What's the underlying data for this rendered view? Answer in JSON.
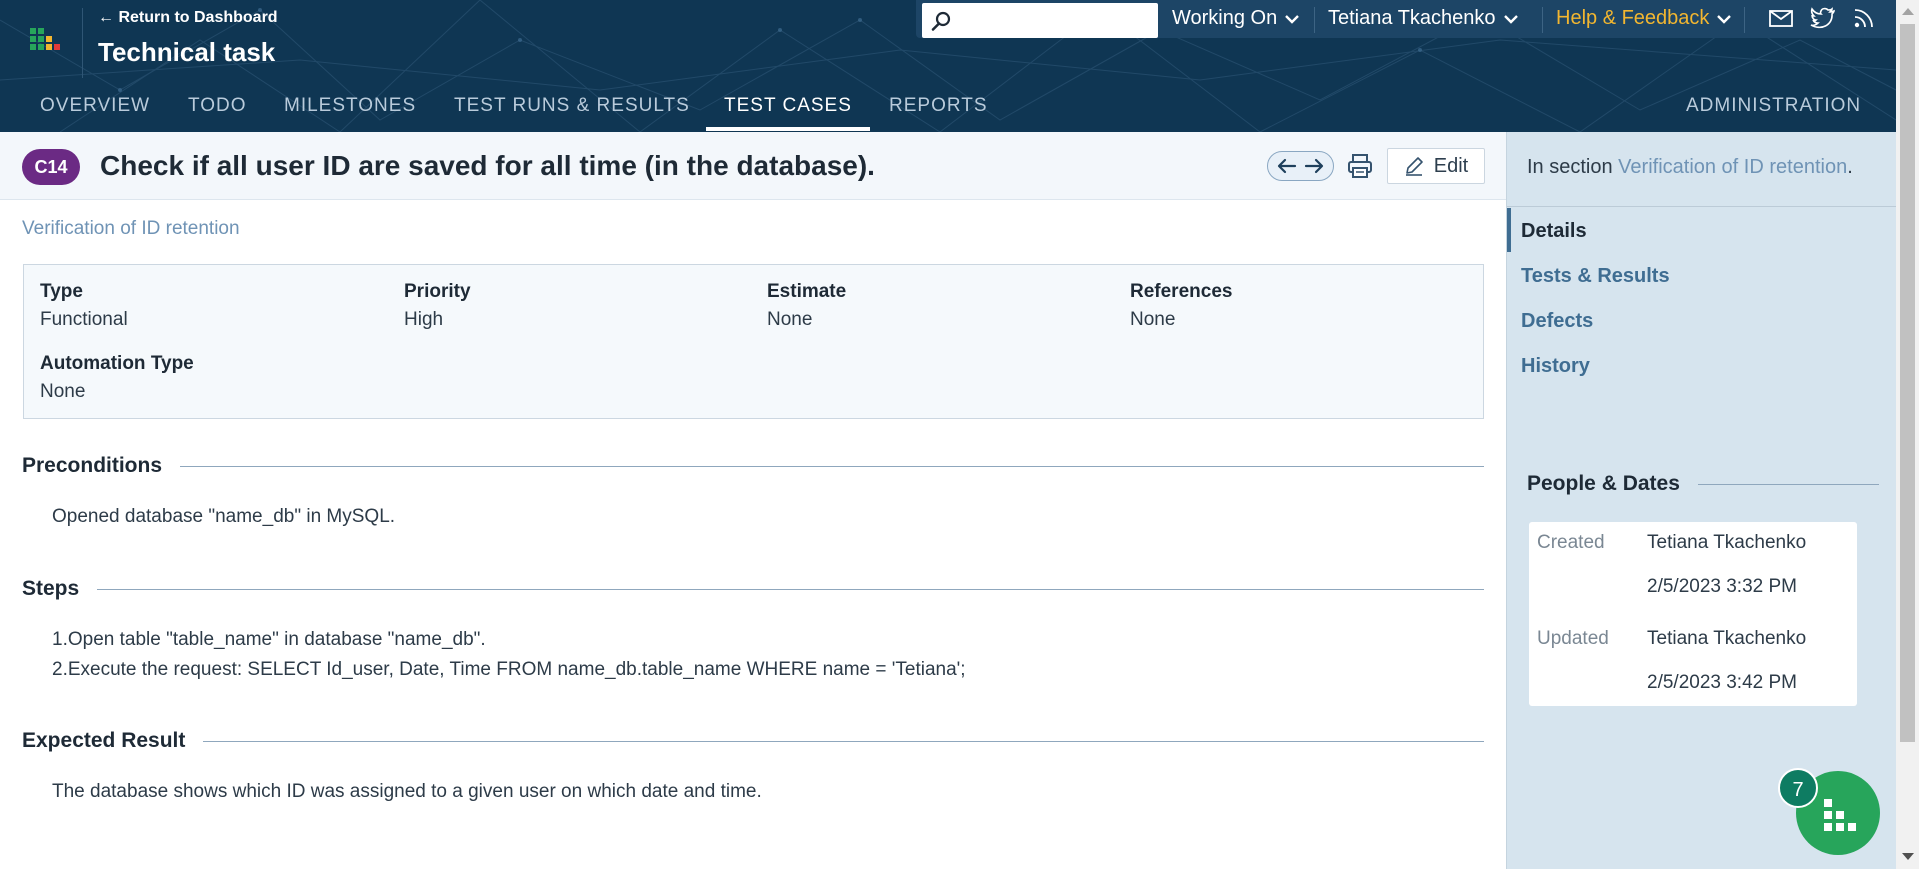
{
  "header": {
    "return_link": "← Return to Dashboard",
    "project_title": "Technical task",
    "search_placeholder": "",
    "working_on": "Working On",
    "user": "Tetiana Tkachenko",
    "help": "Help & Feedback",
    "icons": [
      "logo-icon",
      "search-icon",
      "chevron-down-icon",
      "mail-icon",
      "twitter-icon",
      "rss-icon"
    ]
  },
  "nav": {
    "tabs": [
      "OVERVIEW",
      "TODO",
      "MILESTONES",
      "TEST RUNS & RESULTS",
      "TEST CASES",
      "REPORTS"
    ],
    "active_tab": "TEST CASES",
    "administration": "ADMINISTRATION"
  },
  "case": {
    "id": "C14",
    "title": "Check if all user ID are saved for all time (in the database).",
    "section": "Verification of ID retention",
    "edit_label": "Edit"
  },
  "fields": {
    "type_label": "Type",
    "type_value": "Functional",
    "priority_label": "Priority",
    "priority_value": "High",
    "estimate_label": "Estimate",
    "estimate_value": "None",
    "references_label": "References",
    "references_value": "None",
    "automation_label": "Automation Type",
    "automation_value": "None"
  },
  "preconditions": {
    "heading": "Preconditions",
    "text": "Opened database \"name_db\" in MySQL."
  },
  "steps": {
    "heading": "Steps",
    "items": [
      "1.Open table \"table_name\" in database \"name_db\".",
      "2.Execute the request: SELECT Id_user, Date, Time FROM name_db.table_name WHERE name = 'Tetiana';"
    ]
  },
  "expected": {
    "heading": "Expected Result",
    "text": "The database shows which ID was assigned to a given user on which date and time."
  },
  "sidebar": {
    "in_section_prefix": "In section",
    "in_section_link": "Verification of ID retention",
    "in_section_suffix": ".",
    "nav": [
      "Details",
      "Tests & Results",
      "Defects",
      "History"
    ],
    "active_nav": "Details",
    "people_dates_heading": "People & Dates",
    "created_label": "Created",
    "created_by": "Tetiana Tkachenko",
    "created_at": "2/5/2023 3:32 PM",
    "updated_label": "Updated",
    "updated_by": "Tetiana Tkachenko",
    "updated_at": "2/5/2023 3:42 PM"
  },
  "widget": {
    "count": "7"
  },
  "colors": {
    "header_bg": "#0f3653",
    "badge_bg": "#6b2a84",
    "link": "#6f93b5",
    "help": "#f2b630",
    "widget": "#27a55b"
  }
}
